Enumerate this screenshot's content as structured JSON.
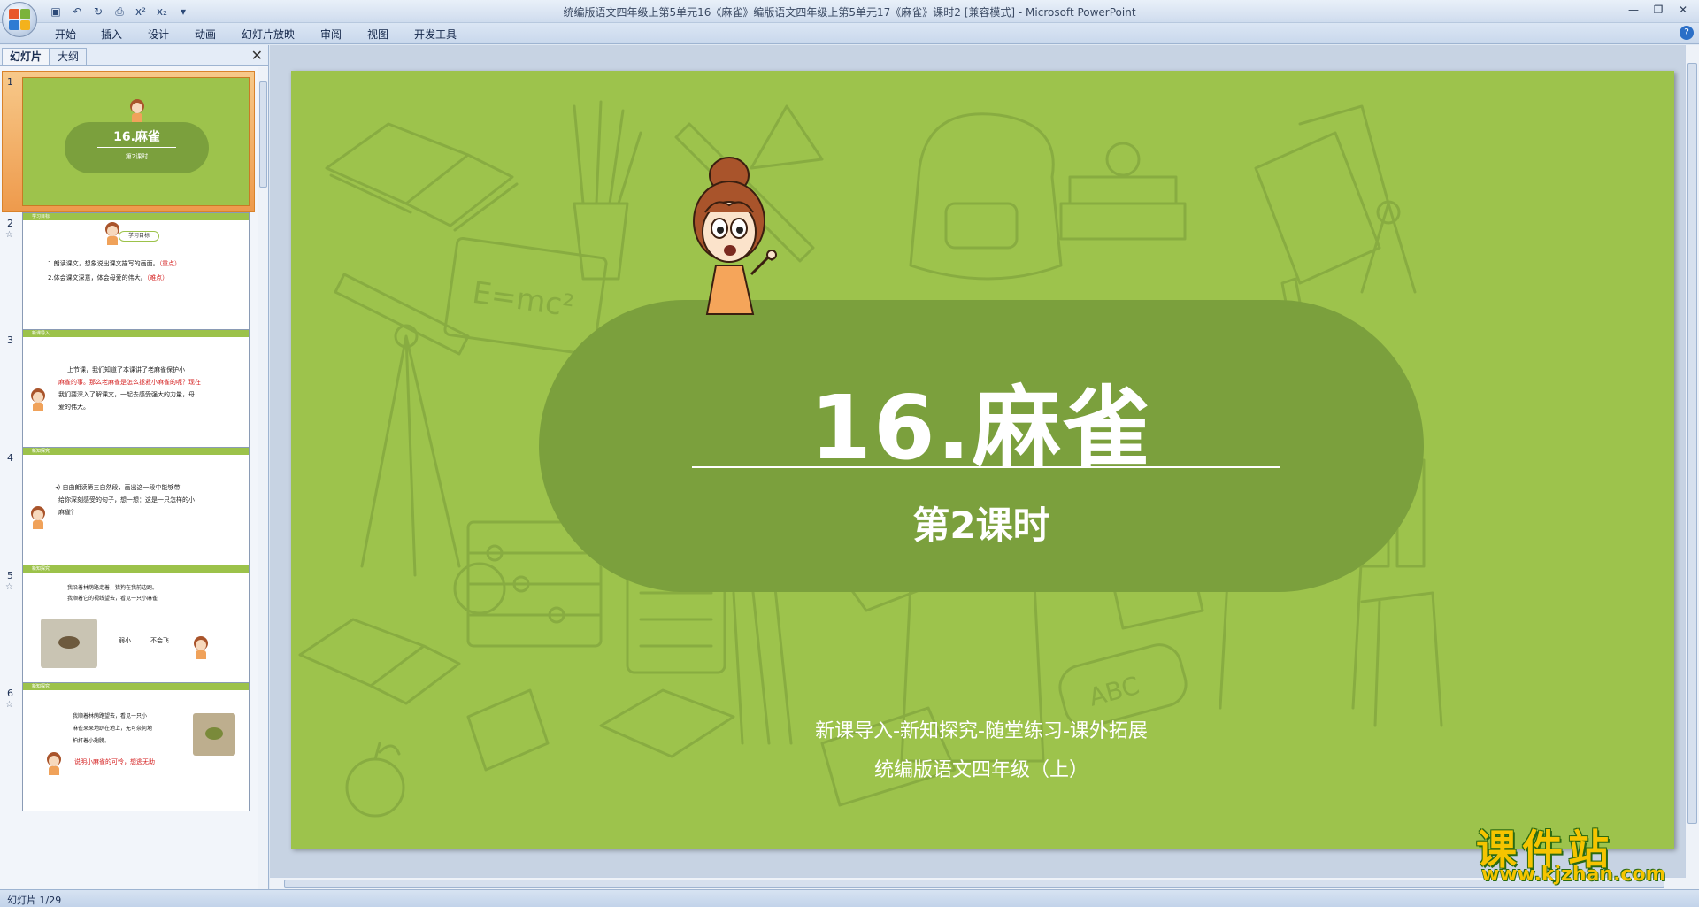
{
  "window": {
    "title": "统编版语文四年级上第5单元16《麻雀》编版语文四年级上第5单元17《麻雀》课时2 [兼容模式] - Microsoft PowerPoint"
  },
  "ribbon": {
    "tabs": [
      "开始",
      "插入",
      "设计",
      "动画",
      "幻灯片放映",
      "审阅",
      "视图",
      "开发工具"
    ]
  },
  "pane": {
    "tabs": [
      "幻灯片",
      "大纲"
    ]
  },
  "thumbnails": [
    {
      "num": "1",
      "title": "16.麻雀",
      "sub": "第2课时"
    },
    {
      "num": "2",
      "header": "学习目标",
      "pill": "学习目标",
      "l1": "1.朗读课文，想象说出课文描写的画面。",
      "l1r": "（重点）",
      "l2": "2.体会课文深意，体会母爱的伟大。",
      "l2r": "（难点）"
    },
    {
      "num": "3",
      "header": "新课导入",
      "l1": "上节课，我们知道了本课讲了老麻雀保护小",
      "l2": "麻雀的事。那么老麻雀是怎么拯救小麻雀的呢？现在",
      "l3": "我们要深入了解课文，一起去感受强大的力量，母",
      "l4": "爱的伟大。"
    },
    {
      "num": "4",
      "header": "新知探究",
      "l1": "自由朗读第三自然段，画出这一段中能够带",
      "l2": "给你深刻感受的句子，想一想：这是一只怎样的小",
      "l3": "麻雀？"
    },
    {
      "num": "5",
      "header": "新知探究",
      "l1": "我沿着林荫路走着，猎狗在我前边跑。",
      "l2": "我顺着它的视线望去，看见一只小麻雀",
      "tag1": "弱小",
      "tag2": "不会飞"
    },
    {
      "num": "6",
      "header": "新知探究",
      "l1": "我顺着林荫路望去，看见一只小",
      "l2": "麻雀呆呆地趴在地上，无可奈何地",
      "l3": "拍打着小翅膀。",
      "note": "说明小麻雀的可怜，想逃无助"
    }
  ],
  "slide": {
    "title": "16.麻雀",
    "subtitle": "第2课时",
    "footer_line1": "新课导入-新知探究-随堂练习-课外拓展",
    "footer_line2": "统编版语文四年级（上）",
    "background_color": "#9dc34c",
    "pill_color": "#7ba03d"
  },
  "status": {
    "slide_indicator": "幻灯片 1/29"
  },
  "watermark": {
    "name": "课件站",
    "url": "www.kjzhan.com"
  }
}
